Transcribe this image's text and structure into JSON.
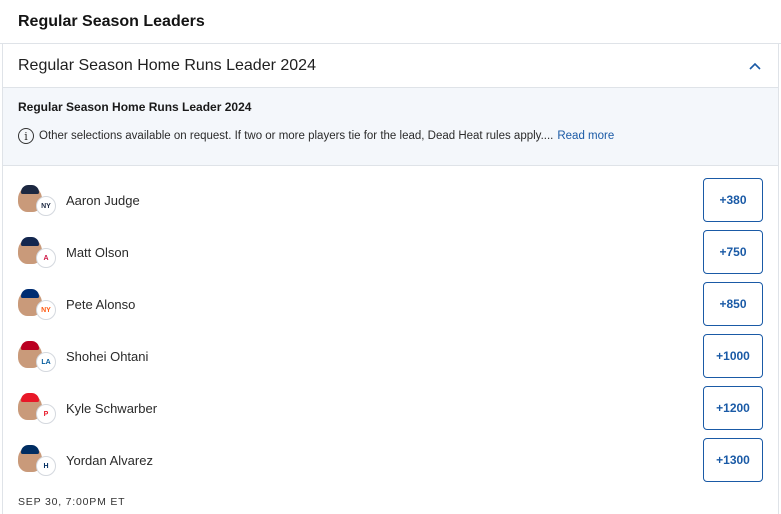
{
  "header": {
    "title": "Regular Season Leaders"
  },
  "market": {
    "name": "Regular Season Home Runs Leader 2024",
    "subtitle": "Regular Season Home Runs Leader 2024",
    "rules_text": "Other selections available on request. If two or more players tie for the lead, Dead Heat rules apply....",
    "read_more": "Read more",
    "chevron_icon": "chevron-up-icon"
  },
  "selections": [
    {
      "player": "Aaron Judge",
      "odds": "+380",
      "team_icon": "yankees-logo-icon",
      "cap_color": "#1c2841",
      "logo_color": "#1c2841",
      "logo_text": "NY"
    },
    {
      "player": "Matt Olson",
      "odds": "+750",
      "team_icon": "braves-logo-icon",
      "cap_color": "#13274f",
      "logo_color": "#ce1141",
      "logo_text": "A"
    },
    {
      "player": "Pete Alonso",
      "odds": "+850",
      "team_icon": "mets-logo-icon",
      "cap_color": "#002d72",
      "logo_color": "#ff5910",
      "logo_text": "NY"
    },
    {
      "player": "Shohei Ohtani",
      "odds": "+1000",
      "team_icon": "dodgers-logo-icon",
      "cap_color": "#ba0021",
      "logo_color": "#005a9c",
      "logo_text": "LA"
    },
    {
      "player": "Kyle Schwarber",
      "odds": "+1200",
      "team_icon": "phillies-logo-icon",
      "cap_color": "#e81828",
      "logo_color": "#e81828",
      "logo_text": "P"
    },
    {
      "player": "Yordan Alvarez",
      "odds": "+1300",
      "team_icon": "astros-logo-icon",
      "cap_color": "#002d62",
      "logo_color": "#002d62",
      "logo_text": "H"
    }
  ],
  "event_time": "SEP 30, 7:00PM ET",
  "colors": {
    "accent": "#1a5aa6",
    "panel_bg": "#f4f7fb",
    "border": "#dfe3e8"
  }
}
